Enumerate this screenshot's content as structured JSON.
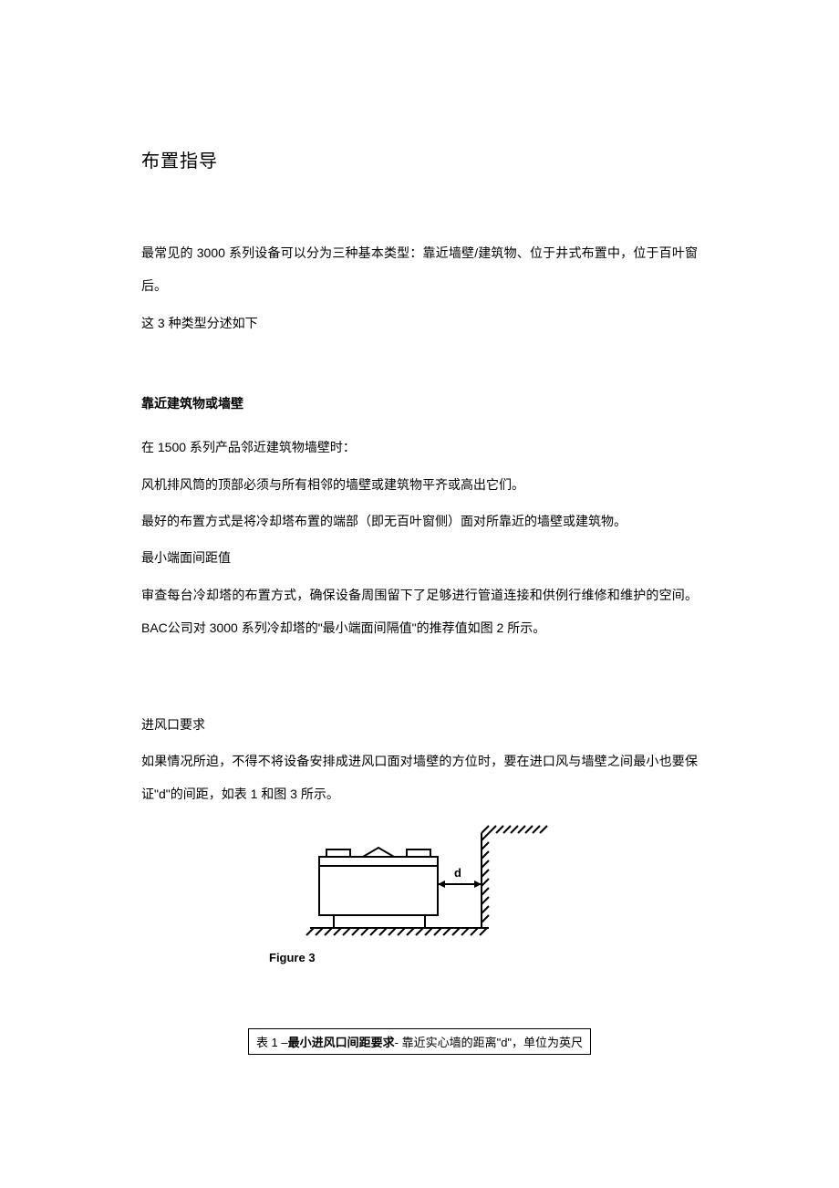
{
  "title": "布置指导",
  "intro1": "最常见的 3000 系列设备可以分为三种基本类型：靠近墙壁/建筑物、位于井式布置中，位于百叶窗后。",
  "intro2": "这 3 种类型分述如下",
  "section1": {
    "heading": "靠近建筑物或墙壁",
    "p1": "在 1500 系列产品邻近建筑物墙壁时：",
    "p2": "风机排风筒的顶部必须与所有相邻的墙壁或建筑物平齐或高出它们。",
    "p3": "最好的布置方式是将冷却塔布置的端部（即无百叶窗侧）面对所靠近的墙壁或建筑物。",
    "p4": "最小端面间距值",
    "p5": "审查每台冷却塔的布置方式，确保设备周围留下了足够进行管道连接和供例行维修和维护的空间。BAC公司对 3000 系列冷却塔的\"最小端面间隔值\"的推荐值如图 2 所示。"
  },
  "section2": {
    "heading": "进风口要求",
    "p1": "如果情况所迫，不得不将设备安排成进风口面对墙壁的方位时，要在进口风与墙壁之间最小也要保证\"d\"的间距，如表 1 和图 3 所示。"
  },
  "figure": {
    "caption": "Figure 3",
    "label_d": "d"
  },
  "table": {
    "title_prefix": "表 1 –",
    "title_bold": "最小进风口间距要求",
    "title_suffix": "- 靠近实心墙的距离\"d\"，单位为英尺"
  }
}
